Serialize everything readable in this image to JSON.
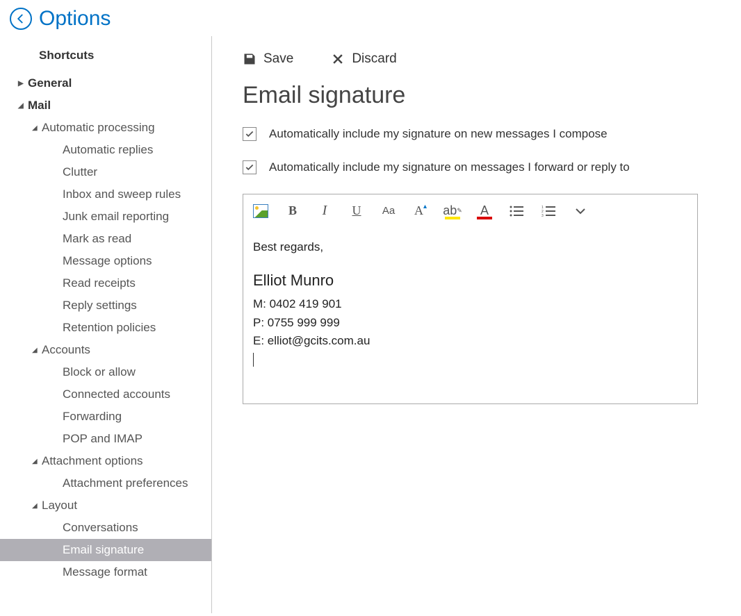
{
  "header": {
    "title": "Options"
  },
  "sidebar": {
    "shortcuts": "Shortcuts",
    "general": "General",
    "mail": "Mail",
    "auto_processing": "Automatic processing",
    "auto_items": [
      "Automatic replies",
      "Clutter",
      "Inbox and sweep rules",
      "Junk email reporting",
      "Mark as read",
      "Message options",
      "Read receipts",
      "Reply settings",
      "Retention policies"
    ],
    "accounts": "Accounts",
    "account_items": [
      "Block or allow",
      "Connected accounts",
      "Forwarding",
      "POP and IMAP"
    ],
    "attachment": "Attachment options",
    "attachment_items": [
      "Attachment preferences"
    ],
    "layout": "Layout",
    "layout_items": [
      "Conversations",
      "Email signature",
      "Message format"
    ]
  },
  "toolbar": {
    "save": "Save",
    "discard": "Discard"
  },
  "page": {
    "title": "Email signature",
    "check1": "Automatically include my signature on new messages I compose",
    "check2": "Automatically include my signature on messages I forward or reply to"
  },
  "signature": {
    "greeting": "Best regards,",
    "name": "Elliot Munro",
    "mobile": "M: 0402 419 901",
    "phone": "P: 0755 999 999",
    "email": "E: elliot@gcits.com.au"
  }
}
